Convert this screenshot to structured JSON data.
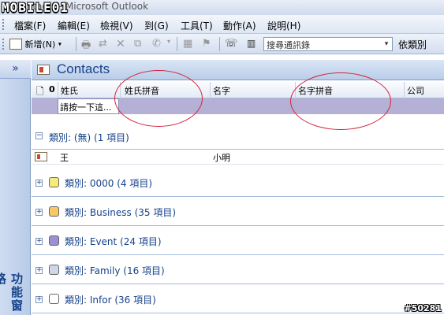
{
  "window": {
    "title": "Contacts - Microsoft Outlook",
    "logo": "MOBILE01"
  },
  "menu": [
    "檔案(F)",
    "編輯(E)",
    "檢視(V)",
    "到(G)",
    "工具(T)",
    "動作(A)",
    "說明(H)"
  ],
  "toolbar": {
    "new_label": "新增(N)",
    "search_placeholder": "搜尋通訊錄",
    "view_label": "依類別"
  },
  "nav_pane": {
    "label": "功能窗格",
    "collapse_glyph": "»"
  },
  "view": {
    "title": "Contacts"
  },
  "columns": [
    "姓氏",
    "姓氏拼音",
    "名字",
    "名字拼音",
    "公司"
  ],
  "filter_placeholder": "請按一下這...",
  "groups": [
    {
      "label": "類別: (無) (1 項目)",
      "expanded": true,
      "color": null
    },
    {
      "label": "類別: 0000 (4 項目)",
      "expanded": false,
      "color": "#f4ec7a"
    },
    {
      "label": "類別: Business (35 項目)",
      "expanded": false,
      "color": "#f6c866"
    },
    {
      "label": "類別: Event (24 項目)",
      "expanded": false,
      "color": "#9d8fd4"
    },
    {
      "label": "類別: Family (16 項目)",
      "expanded": false,
      "color": "#cfd8ea"
    },
    {
      "label": "類別: Infor (36 項目)",
      "expanded": false,
      "color": "#ffffff"
    }
  ],
  "rows": [
    {
      "surname": "王",
      "given": "小明"
    }
  ],
  "watermark": "#50281"
}
